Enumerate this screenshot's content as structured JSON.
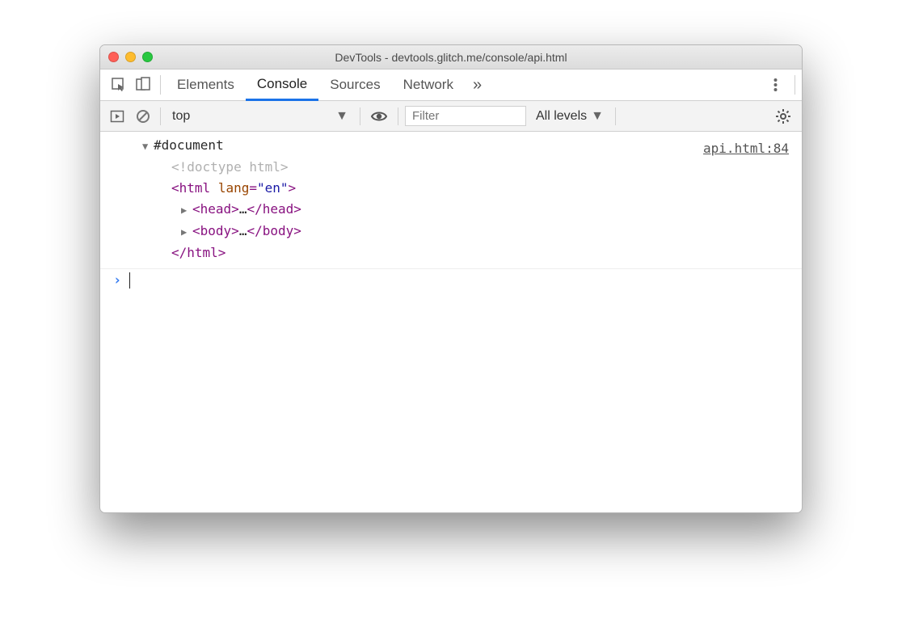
{
  "window": {
    "title": "DevTools - devtools.glitch.me/console/api.html"
  },
  "tabs": {
    "elements": "Elements",
    "console": "Console",
    "sources": "Sources",
    "network": "Network"
  },
  "toolbar": {
    "context": "top",
    "filter_placeholder": "Filter",
    "levels_label": "All levels"
  },
  "console": {
    "source_link": "api.html:84",
    "doc_label": "#document",
    "doctype_text": "<!doctype html>",
    "html_open_tag": "html",
    "html_attr_name": "lang",
    "html_attr_val": "\"en\"",
    "head_tag": "head",
    "body_tag": "body",
    "ellipsis": "…",
    "html_close": "html"
  }
}
